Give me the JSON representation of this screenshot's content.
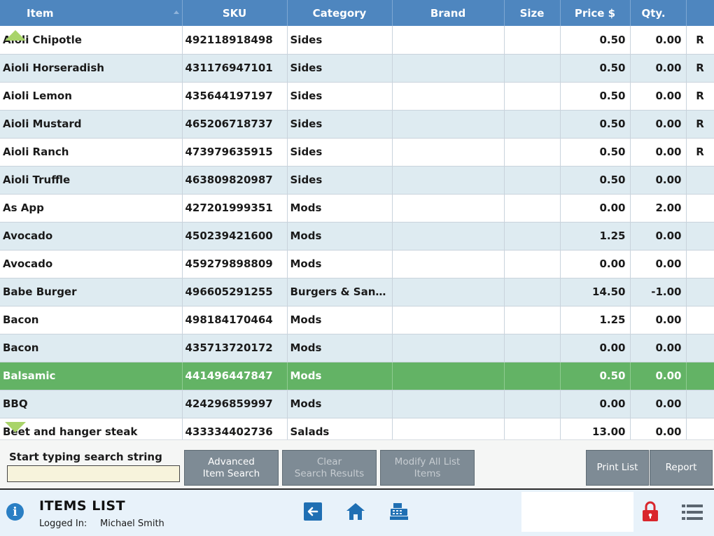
{
  "table": {
    "columns": [
      "Item",
      "SKU",
      "Category",
      "Brand",
      "Size",
      "Price $",
      "Qty.",
      ""
    ],
    "rows": [
      {
        "item": "Aioli Chipotle",
        "sku": "492118918498",
        "category": "Sides",
        "brand": "",
        "size": "",
        "price": "0.50",
        "qty": "0.00",
        "flag": "R"
      },
      {
        "item": "Aioli Horseradish",
        "sku": "431176947101",
        "category": "Sides",
        "brand": "",
        "size": "",
        "price": "0.50",
        "qty": "0.00",
        "flag": "R"
      },
      {
        "item": "Aioli Lemon",
        "sku": "435644197197",
        "category": "Sides",
        "brand": "",
        "size": "",
        "price": "0.50",
        "qty": "0.00",
        "flag": "R"
      },
      {
        "item": "Aioli Mustard",
        "sku": "465206718737",
        "category": "Sides",
        "brand": "",
        "size": "",
        "price": "0.50",
        "qty": "0.00",
        "flag": "R"
      },
      {
        "item": "Aioli Ranch",
        "sku": "473979635915",
        "category": "Sides",
        "brand": "",
        "size": "",
        "price": "0.50",
        "qty": "0.00",
        "flag": "R"
      },
      {
        "item": "Aioli Truffle",
        "sku": "463809820987",
        "category": "Sides",
        "brand": "",
        "size": "",
        "price": "0.50",
        "qty": "0.00",
        "flag": ""
      },
      {
        "item": "As App",
        "sku": "427201999351",
        "category": "Mods",
        "brand": "",
        "size": "",
        "price": "0.00",
        "qty": "2.00",
        "flag": ""
      },
      {
        "item": "Avocado",
        "sku": "450239421600",
        "category": "Mods",
        "brand": "",
        "size": "",
        "price": "1.25",
        "qty": "0.00",
        "flag": ""
      },
      {
        "item": "Avocado",
        "sku": "459279898809",
        "category": "Mods",
        "brand": "",
        "size": "",
        "price": "0.00",
        "qty": "0.00",
        "flag": ""
      },
      {
        "item": "Babe Burger",
        "sku": "496605291255",
        "category": "Burgers & Sand...",
        "brand": "",
        "size": "",
        "price": "14.50",
        "qty": "-1.00",
        "flag": ""
      },
      {
        "item": "Bacon",
        "sku": "498184170464",
        "category": "Mods",
        "brand": "",
        "size": "",
        "price": "1.25",
        "qty": "0.00",
        "flag": ""
      },
      {
        "item": "Bacon",
        "sku": "435713720172",
        "category": "Mods",
        "brand": "",
        "size": "",
        "price": "0.00",
        "qty": "0.00",
        "flag": ""
      },
      {
        "item": "Balsamic",
        "sku": "441496447847",
        "category": "Mods",
        "brand": "",
        "size": "",
        "price": "0.50",
        "qty": "0.00",
        "flag": "",
        "selected": true
      },
      {
        "item": "BBQ",
        "sku": "424296859997",
        "category": "Mods",
        "brand": "",
        "size": "",
        "price": "0.00",
        "qty": "0.00",
        "flag": ""
      },
      {
        "item": "Beet and hanger steak",
        "sku": "433334402736",
        "category": "Salads",
        "brand": "",
        "size": "",
        "price": "13.00",
        "qty": "0.00",
        "flag": ""
      }
    ]
  },
  "search": {
    "label": "Start typing search string",
    "value": "",
    "placeholder": ""
  },
  "actions": {
    "advanced_search": "Advanced\nItem Search",
    "clear_results": "Clear\nSearch Results",
    "modify_all": "Modify All List\nItems",
    "print_list": "Print List",
    "report": "Report"
  },
  "footer": {
    "title": "ITEMS LIST",
    "logged_in_label": "Logged In:",
    "user": "Michael Smith",
    "icons": [
      "info-icon",
      "back-icon",
      "home-icon",
      "register-icon",
      "lock-icon",
      "menu-icon"
    ]
  },
  "colors": {
    "header": "#4e86bf",
    "row_alt": "#deebf1",
    "selected_row": "#63b365",
    "button": "#7e8b95",
    "footer_bg": "#e8f2fa",
    "icon_blue": "#1f6fb3",
    "lock_red": "#d9262c"
  }
}
